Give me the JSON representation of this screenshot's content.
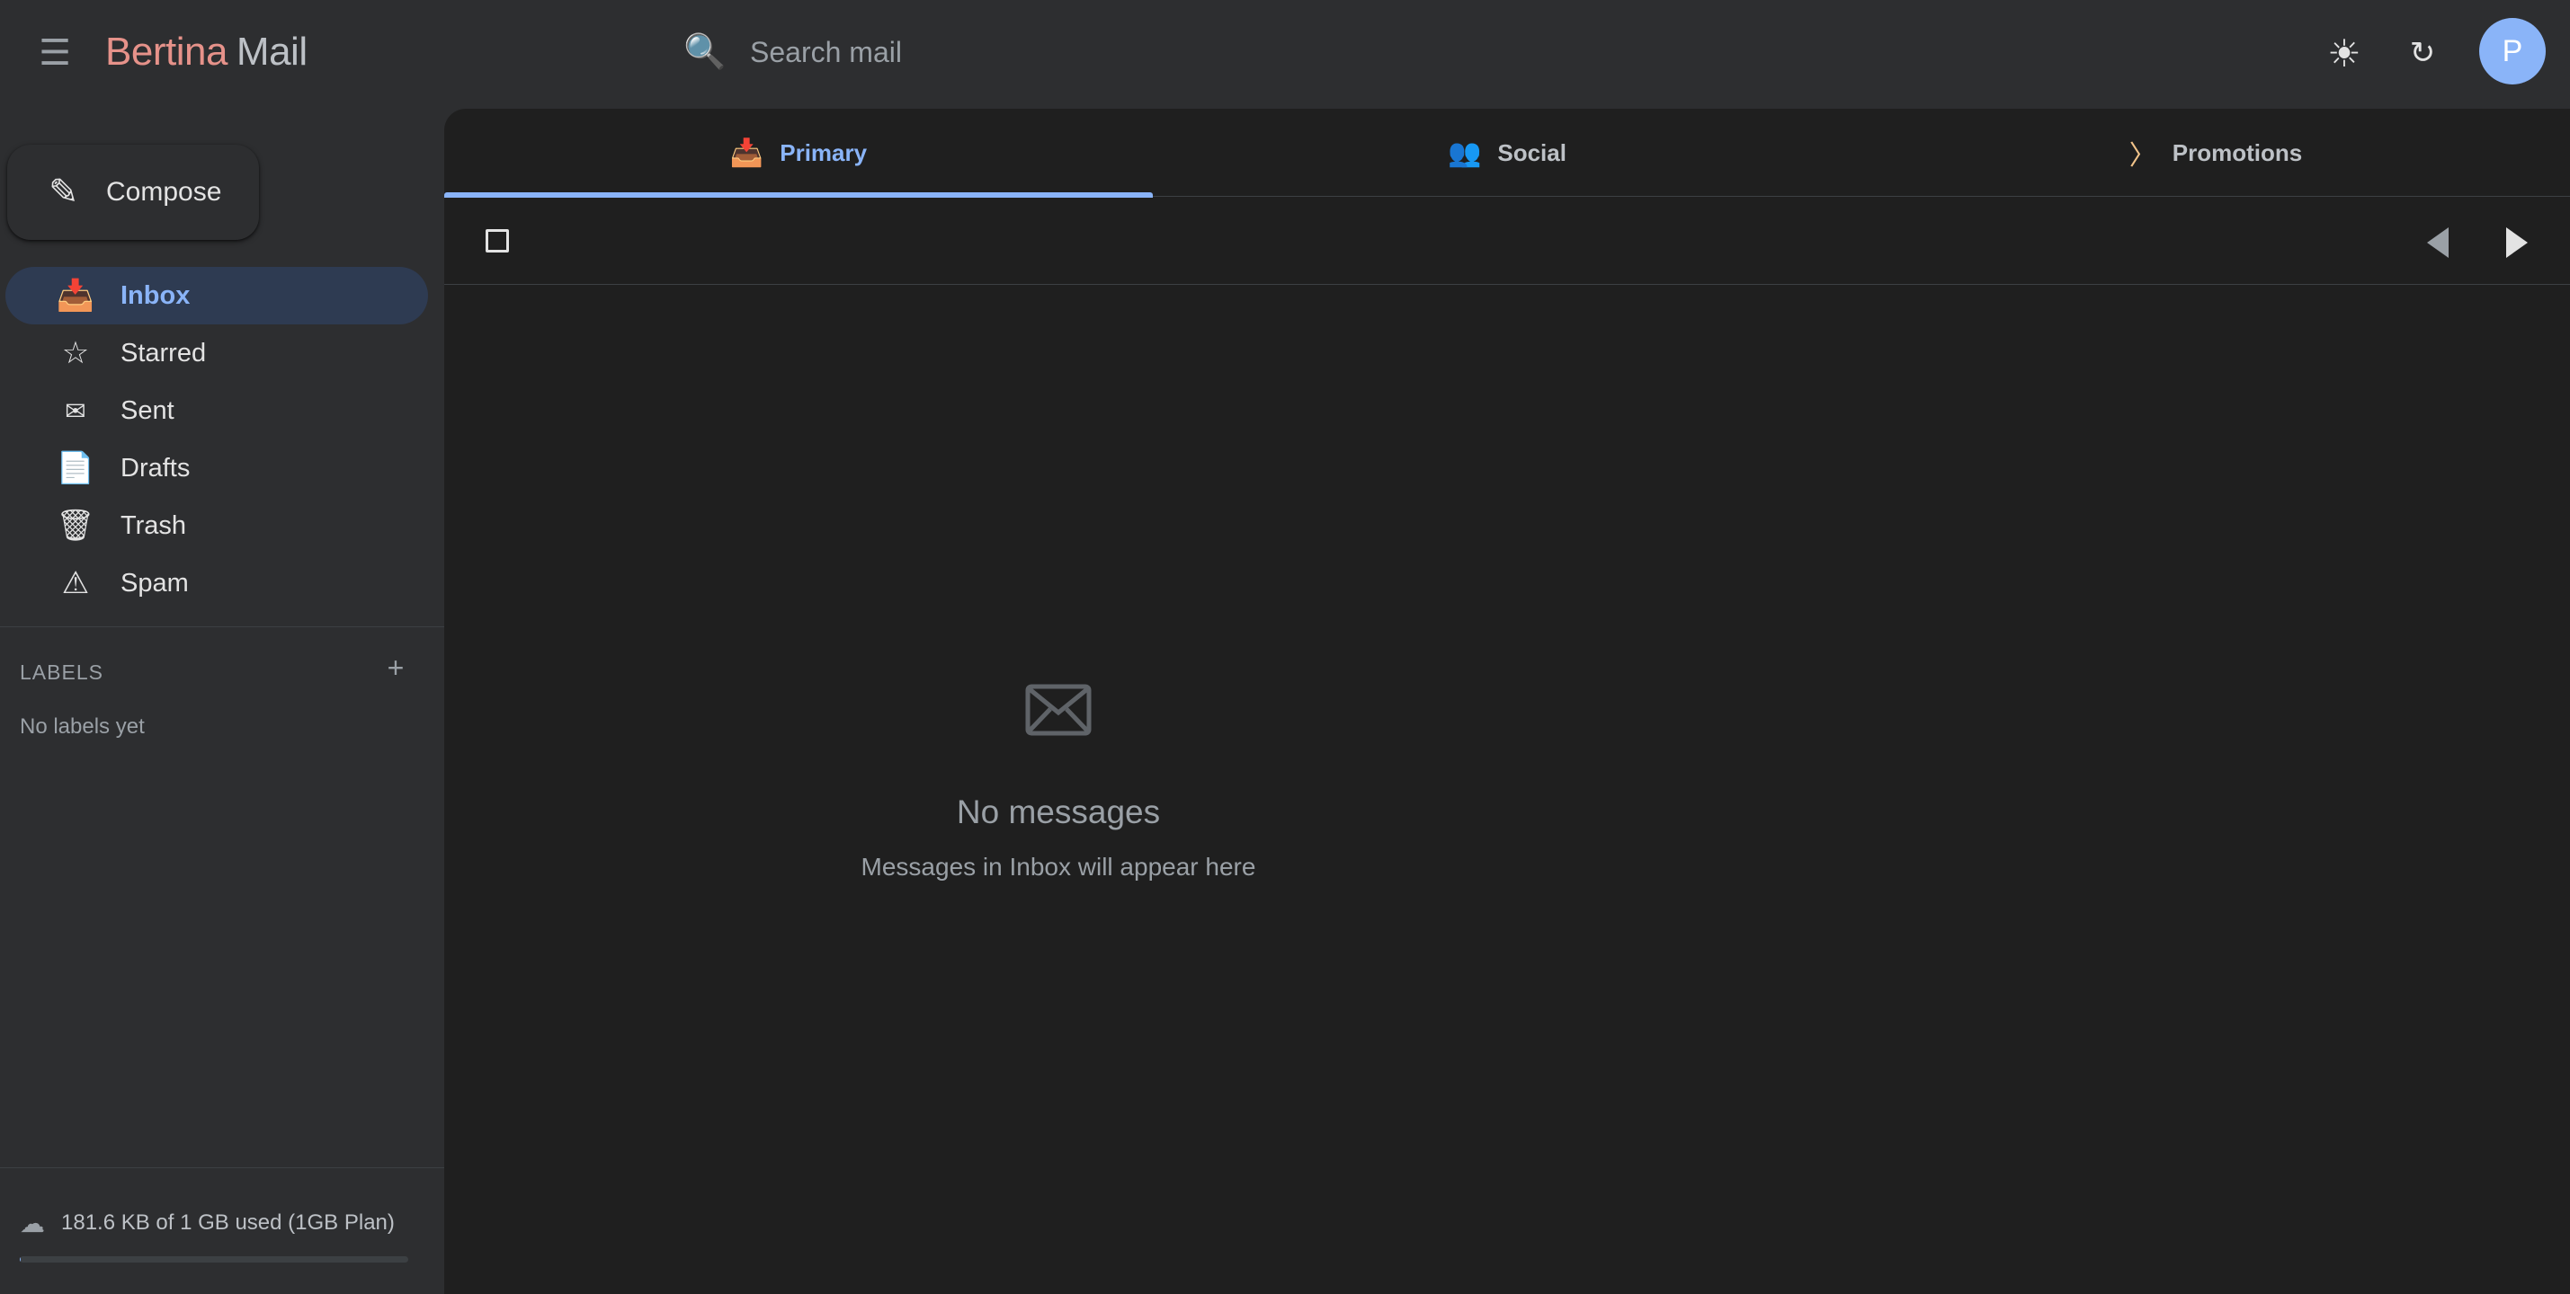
{
  "header": {
    "menu_icon": "hamburger-menu-icon",
    "brand": "Bertina",
    "product": "Mail",
    "search_placeholder": "Search mail",
    "theme_icon": "sun-icon",
    "refresh_icon": "refresh-icon",
    "avatar_initial": "P"
  },
  "sidebar": {
    "compose_label": "Compose",
    "items": [
      {
        "label": "Inbox",
        "icon": "inbox-icon",
        "active": true
      },
      {
        "label": "Starred",
        "icon": "star-icon",
        "active": false
      },
      {
        "label": "Sent",
        "icon": "envelope-icon",
        "active": false
      },
      {
        "label": "Drafts",
        "icon": "document-icon",
        "active": false
      },
      {
        "label": "Trash",
        "icon": "wastebasket-icon",
        "active": false
      },
      {
        "label": "Spam",
        "icon": "warning-icon",
        "active": false
      }
    ],
    "labels_title": "LABELS",
    "labels_empty": "No labels yet",
    "storage_text": "181.6 KB of 1 GB used (1GB Plan)",
    "storage_fraction": 0.0002
  },
  "tabs": [
    {
      "label": "Primary",
      "icon": "inbox-tray-icon",
      "active": true
    },
    {
      "label": "Social",
      "icon": "people-icon",
      "active": false
    },
    {
      "label": "Promotions",
      "icon": "tag-icon",
      "active": false
    }
  ],
  "empty_state": {
    "title": "No messages",
    "subtitle": "Messages in Inbox will appear here"
  },
  "colors": {
    "accent": "#8ab4f8",
    "brand": "#e6928a",
    "background": "#2d2e30",
    "panel": "#1f1f1f"
  }
}
